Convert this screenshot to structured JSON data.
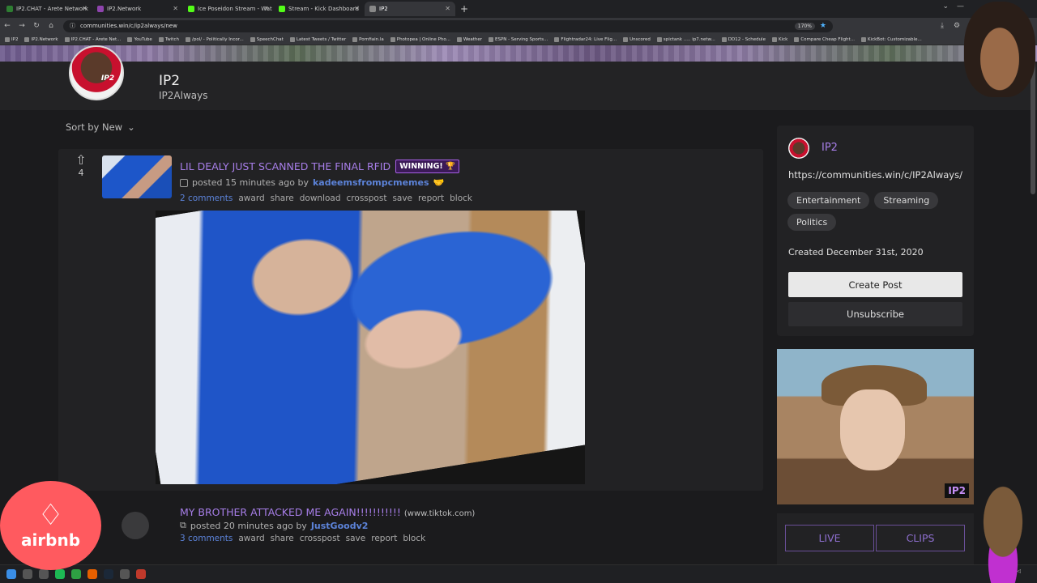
{
  "browser": {
    "tabs": [
      {
        "label": "IP2.CHAT - Arete Network",
        "color": "#2e7d32"
      },
      {
        "label": "IP2.Network",
        "color": "#8e44ad"
      },
      {
        "label": "Ice Poseidon Stream - Wat",
        "color": "#53fc18"
      },
      {
        "label": "Stream - Kick Dashboard",
        "color": "#53fc18"
      },
      {
        "label": "IP2",
        "color": "#888888"
      }
    ],
    "url": "communities.win/c/ip2always/new",
    "zoom": "170%",
    "bookmarks": [
      "IP2",
      "IP2.Network",
      "IP2.CHAT - Arete Net...",
      "YouTube",
      "Twitch",
      "/pol/ - Politically Incor...",
      "SpeechChat",
      "Latest Tweets / Twitter",
      "Pornfiain.la",
      "Photopea | Online Pho...",
      "Weather",
      "ESPN - Serving Sports...",
      "Flightradar24: Live Flig...",
      "Unscored",
      "spictank ..... ip7.netw...",
      "DD12 - Schedule",
      "Kick",
      "Compare Cheap Flight...",
      "KickBot: Customizable..."
    ]
  },
  "community": {
    "logo_text": "IP2",
    "title": "IP2",
    "subtitle": "IP2Always"
  },
  "sort": {
    "label": "Sort by New"
  },
  "posts": [
    {
      "votes": "4",
      "title": "LIL DEALY JUST SCANNED THE FINAL RFID",
      "flair": "WINNING! 🏆",
      "posted": "posted 15 minutes ago by",
      "author": "kadeemsfrompcmemes",
      "comments": "2 comments",
      "actions": [
        "award",
        "share",
        "download",
        "crosspost",
        "save",
        "report",
        "block"
      ]
    },
    {
      "title": "MY BROTHER ATTACKED ME AGAIN!!!!!!!!!!!",
      "domain": "(www.tiktok.com)",
      "posted": "posted 20 minutes ago by",
      "author": "JustGoodv2",
      "comments": "3 comments",
      "actions": [
        "award",
        "share",
        "crosspost",
        "save",
        "report",
        "block"
      ]
    }
  ],
  "sidebar": {
    "name": "IP2",
    "url": "https://communities.win/c/IP2Always/",
    "tags": [
      "Entertainment",
      "Streaming",
      "Politics"
    ],
    "created": "Created December 31st, 2020",
    "create_post": "Create Post",
    "unsubscribe": "Unsubscribe",
    "image_logo": "IP2",
    "links": [
      "LIVE",
      "CLIPS"
    ]
  },
  "overlay": {
    "airbnb_word": "airbnb"
  },
  "colors": {
    "accent": "#a77ee8",
    "author": "#5c83d9",
    "airbnb": "#ff5a5f"
  }
}
